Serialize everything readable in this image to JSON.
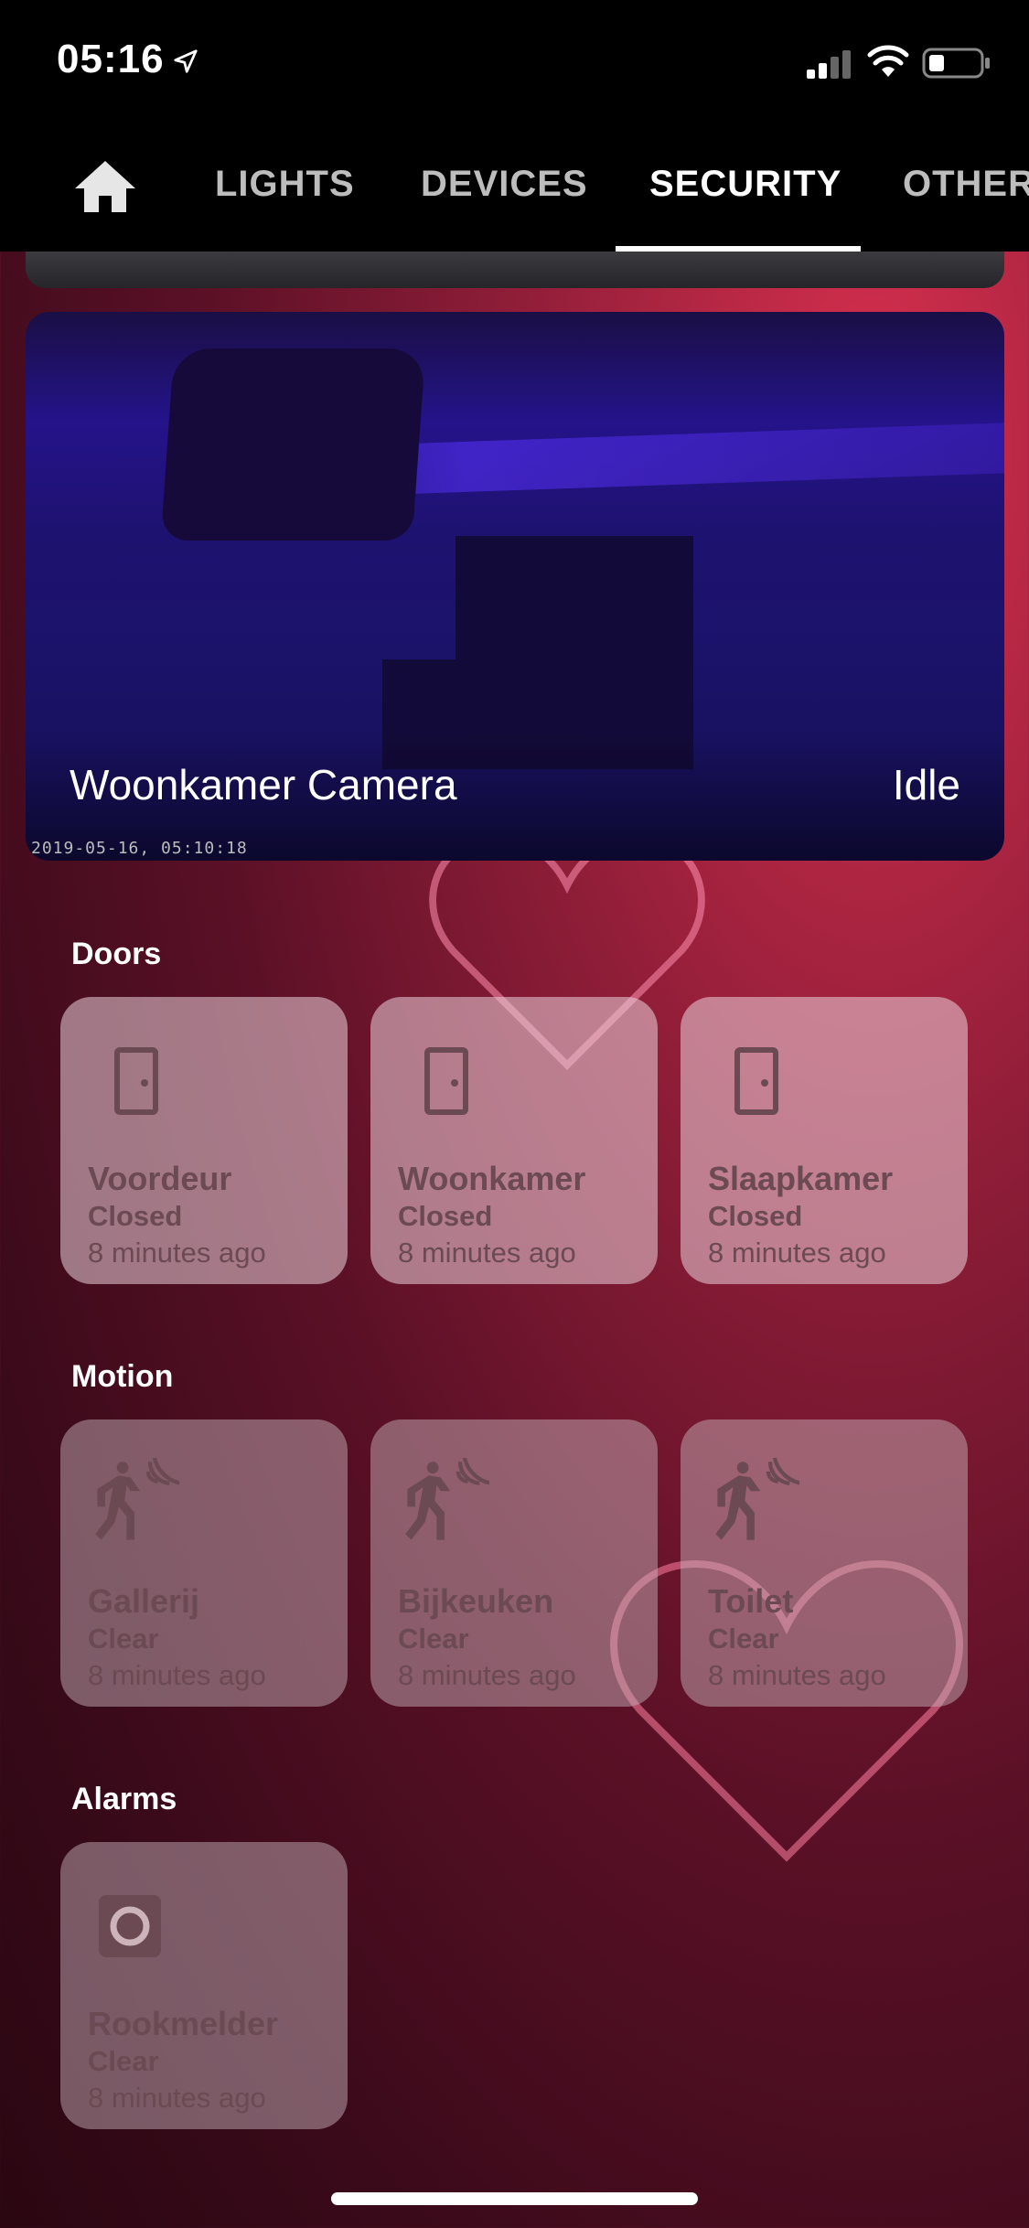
{
  "status_bar": {
    "time": "05:16",
    "icons": [
      "location-arrow-icon",
      "cellular-signal-icon",
      "wifi-icon",
      "battery-icon"
    ]
  },
  "tabs": {
    "home_icon": "home-icon",
    "items": [
      {
        "label": "LIGHTS",
        "active": false
      },
      {
        "label": "DEVICES",
        "active": false
      },
      {
        "label": "SECURITY",
        "active": true
      },
      {
        "label": "OTHER",
        "active": false
      }
    ]
  },
  "camera": {
    "name": "Woonkamer Camera",
    "state": "Idle",
    "timestamp": "2019-05-16, 05:10:18"
  },
  "sections": {
    "doors": {
      "title": "Doors",
      "tiles": [
        {
          "name": "Voordeur",
          "state": "Closed",
          "time": "8 minutes ago",
          "icon": "door-icon"
        },
        {
          "name": "Woonkamer",
          "state": "Closed",
          "time": "8 minutes ago",
          "icon": "door-icon"
        },
        {
          "name": "Slaapkamer",
          "state": "Closed",
          "time": "8 minutes ago",
          "icon": "door-icon"
        }
      ]
    },
    "motion": {
      "title": "Motion",
      "tiles": [
        {
          "name": "Gallerij",
          "state": "Clear",
          "time": "8 minutes ago",
          "icon": "motion-sensor-icon"
        },
        {
          "name": "Bijkeuken",
          "state": "Clear",
          "time": "8 minutes ago",
          "icon": "motion-sensor-icon"
        },
        {
          "name": "Toilet",
          "state": "Clear",
          "time": "8 minutes ago",
          "icon": "motion-sensor-icon"
        }
      ]
    },
    "alarms": {
      "title": "Alarms",
      "tiles": [
        {
          "name": "Rookmelder",
          "state": "Clear",
          "time": "8 minutes ago",
          "icon": "smoke-detector-icon"
        }
      ]
    }
  },
  "colors": {
    "tile_text": "#6c4a54",
    "tab_active": "#ffffff",
    "tab_inactive": "#bdbdbd"
  }
}
